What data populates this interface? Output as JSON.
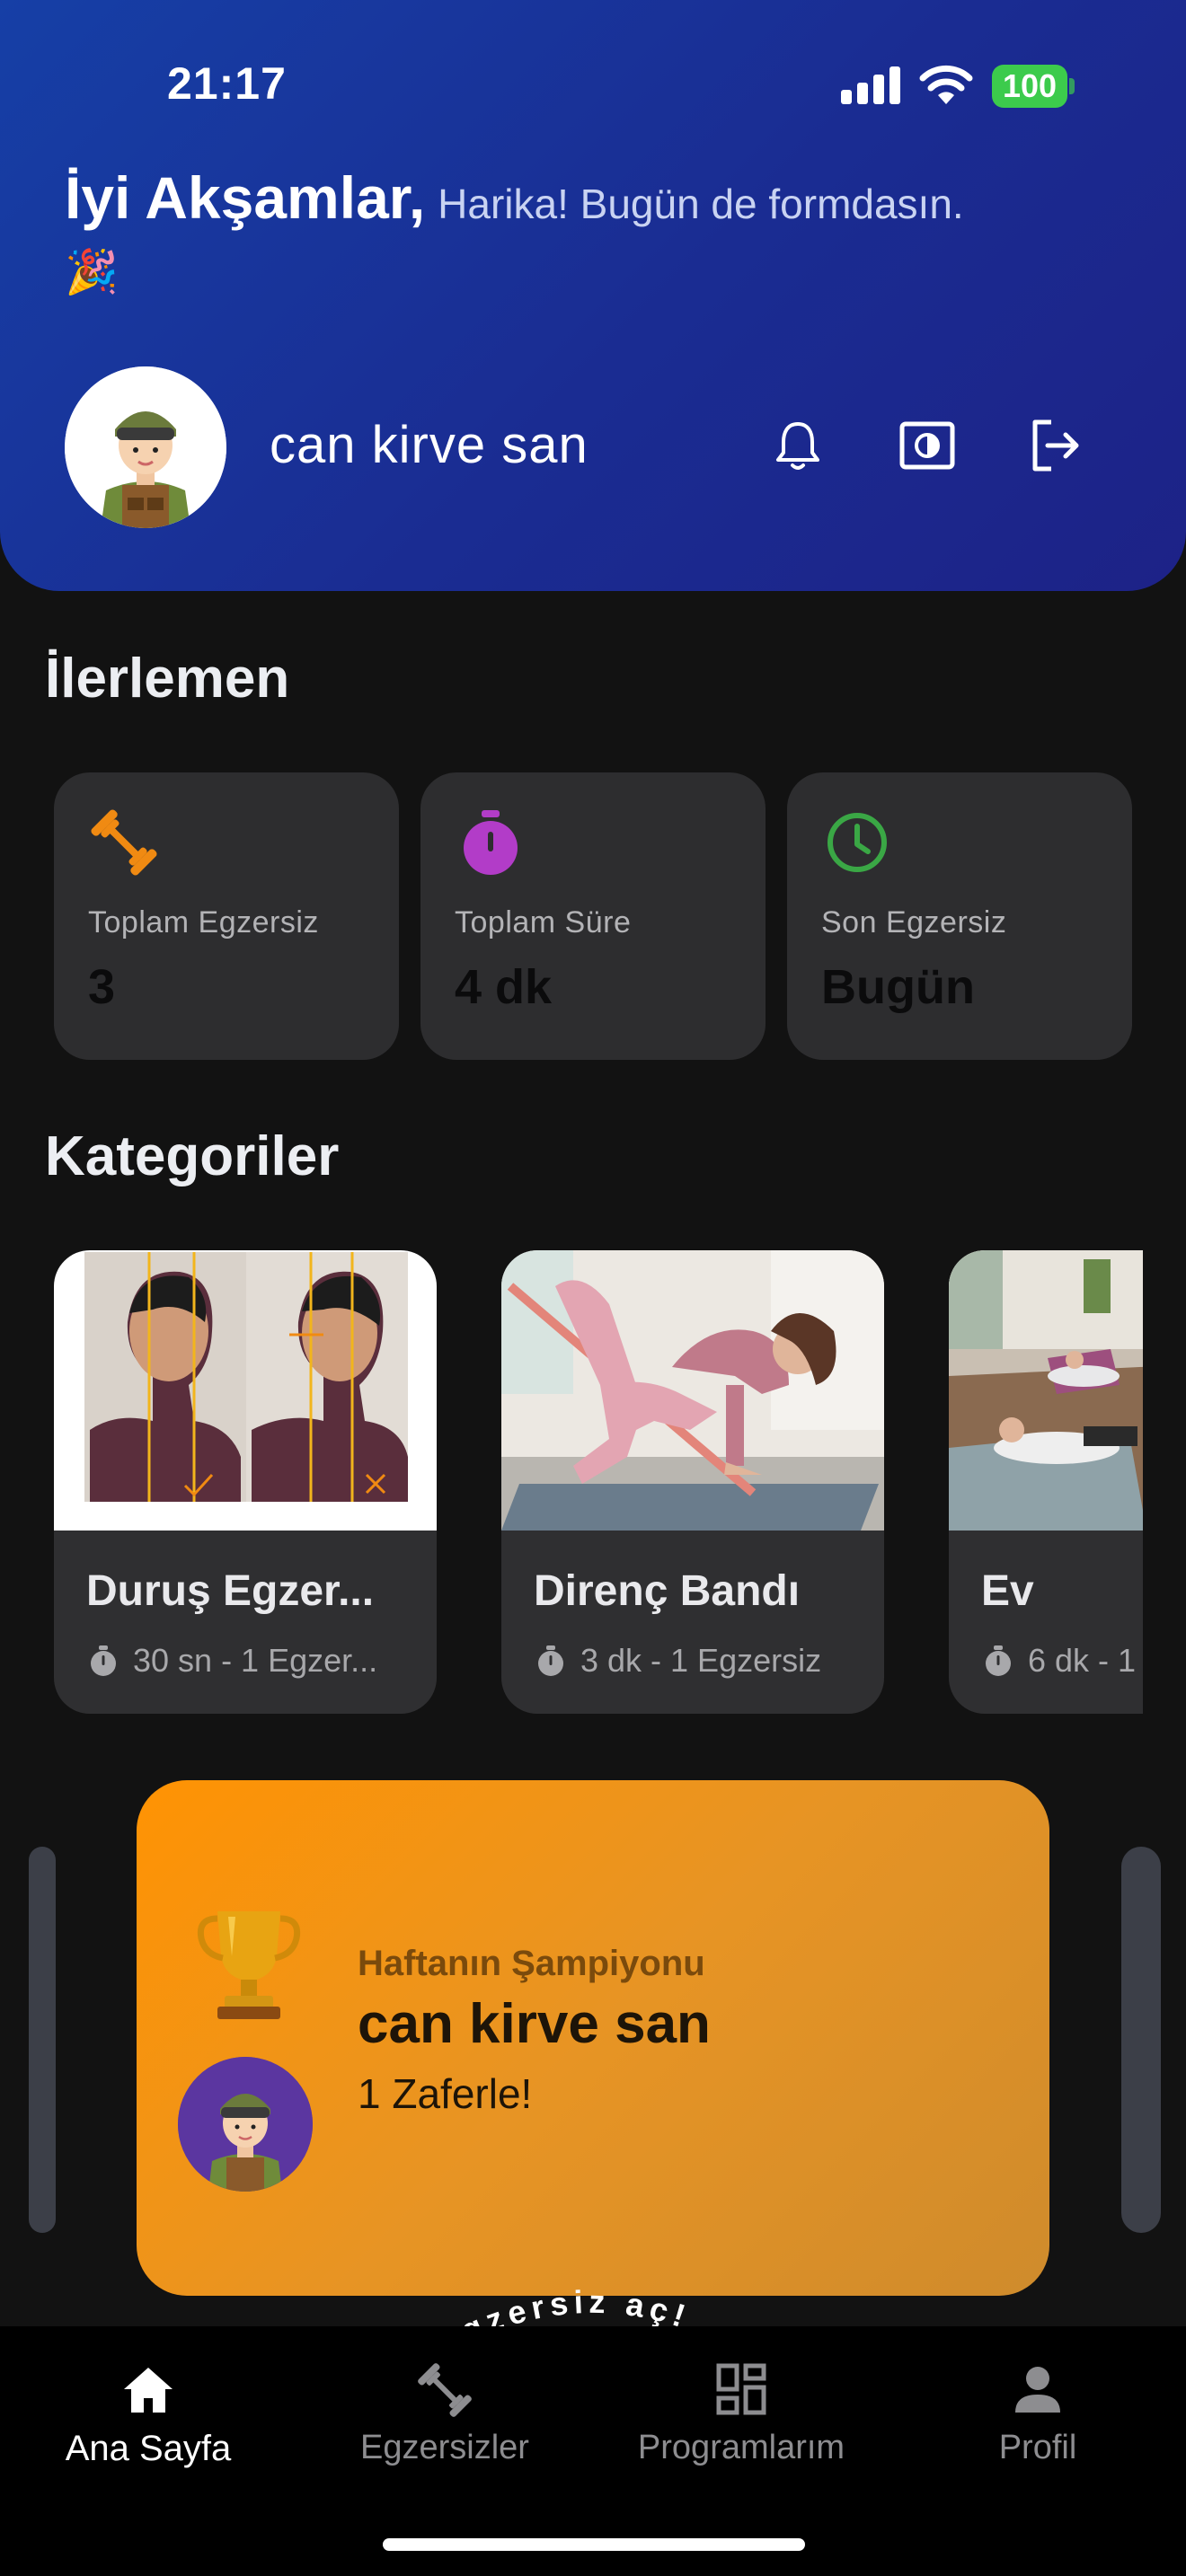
{
  "status_bar": {
    "time": "21:17",
    "battery": "100"
  },
  "header": {
    "greeting": "İyi Akşamlar,",
    "subtitle": "Harika! Bugün de formdasın.",
    "emoji": "🎉",
    "username": "can kirve san",
    "icons": [
      "bell-icon",
      "theme-toggle-icon",
      "logout-icon"
    ]
  },
  "progress": {
    "title": "İlerlemen",
    "stats": [
      {
        "label": "Toplam Egzersiz",
        "value": "3",
        "icon": "dumbbell-icon",
        "color": "#f08a12"
      },
      {
        "label": "Toplam Süre",
        "value": "4 dk",
        "icon": "stopwatch-icon",
        "color": "#b23cc8"
      },
      {
        "label": "Son Egzersiz",
        "value": "Bugün",
        "icon": "clock-icon",
        "color": "#3aa745"
      }
    ]
  },
  "categories": {
    "title": "Kategoriler",
    "items": [
      {
        "name": "Duruş Egzer...",
        "meta": "30 sn - 1 Egzer..."
      },
      {
        "name": "Direnç Bandı",
        "meta": "3 dk - 1 Egzersiz"
      },
      {
        "name": "Ev",
        "meta": "6 dk - 1"
      }
    ]
  },
  "champion": {
    "label": "Haftanın Şampiyonu",
    "name": "can kirve san",
    "wins": "1 Zaferle!",
    "curved_text": "gzersiz aç!"
  },
  "nav": {
    "items": [
      {
        "label": "Ana Sayfa",
        "icon": "home-icon",
        "active": true
      },
      {
        "label": "Egzersizler",
        "icon": "dumbbell-icon",
        "active": false
      },
      {
        "label": "Programlarım",
        "icon": "dashboard-icon",
        "active": false
      },
      {
        "label": "Profil",
        "icon": "person-icon",
        "active": false
      }
    ]
  },
  "colors": {
    "header_start": "#163fa6",
    "header_end": "#1d2287",
    "champion_start": "#ff9303",
    "champion_end": "#cf8b2c",
    "background": "#121212"
  }
}
